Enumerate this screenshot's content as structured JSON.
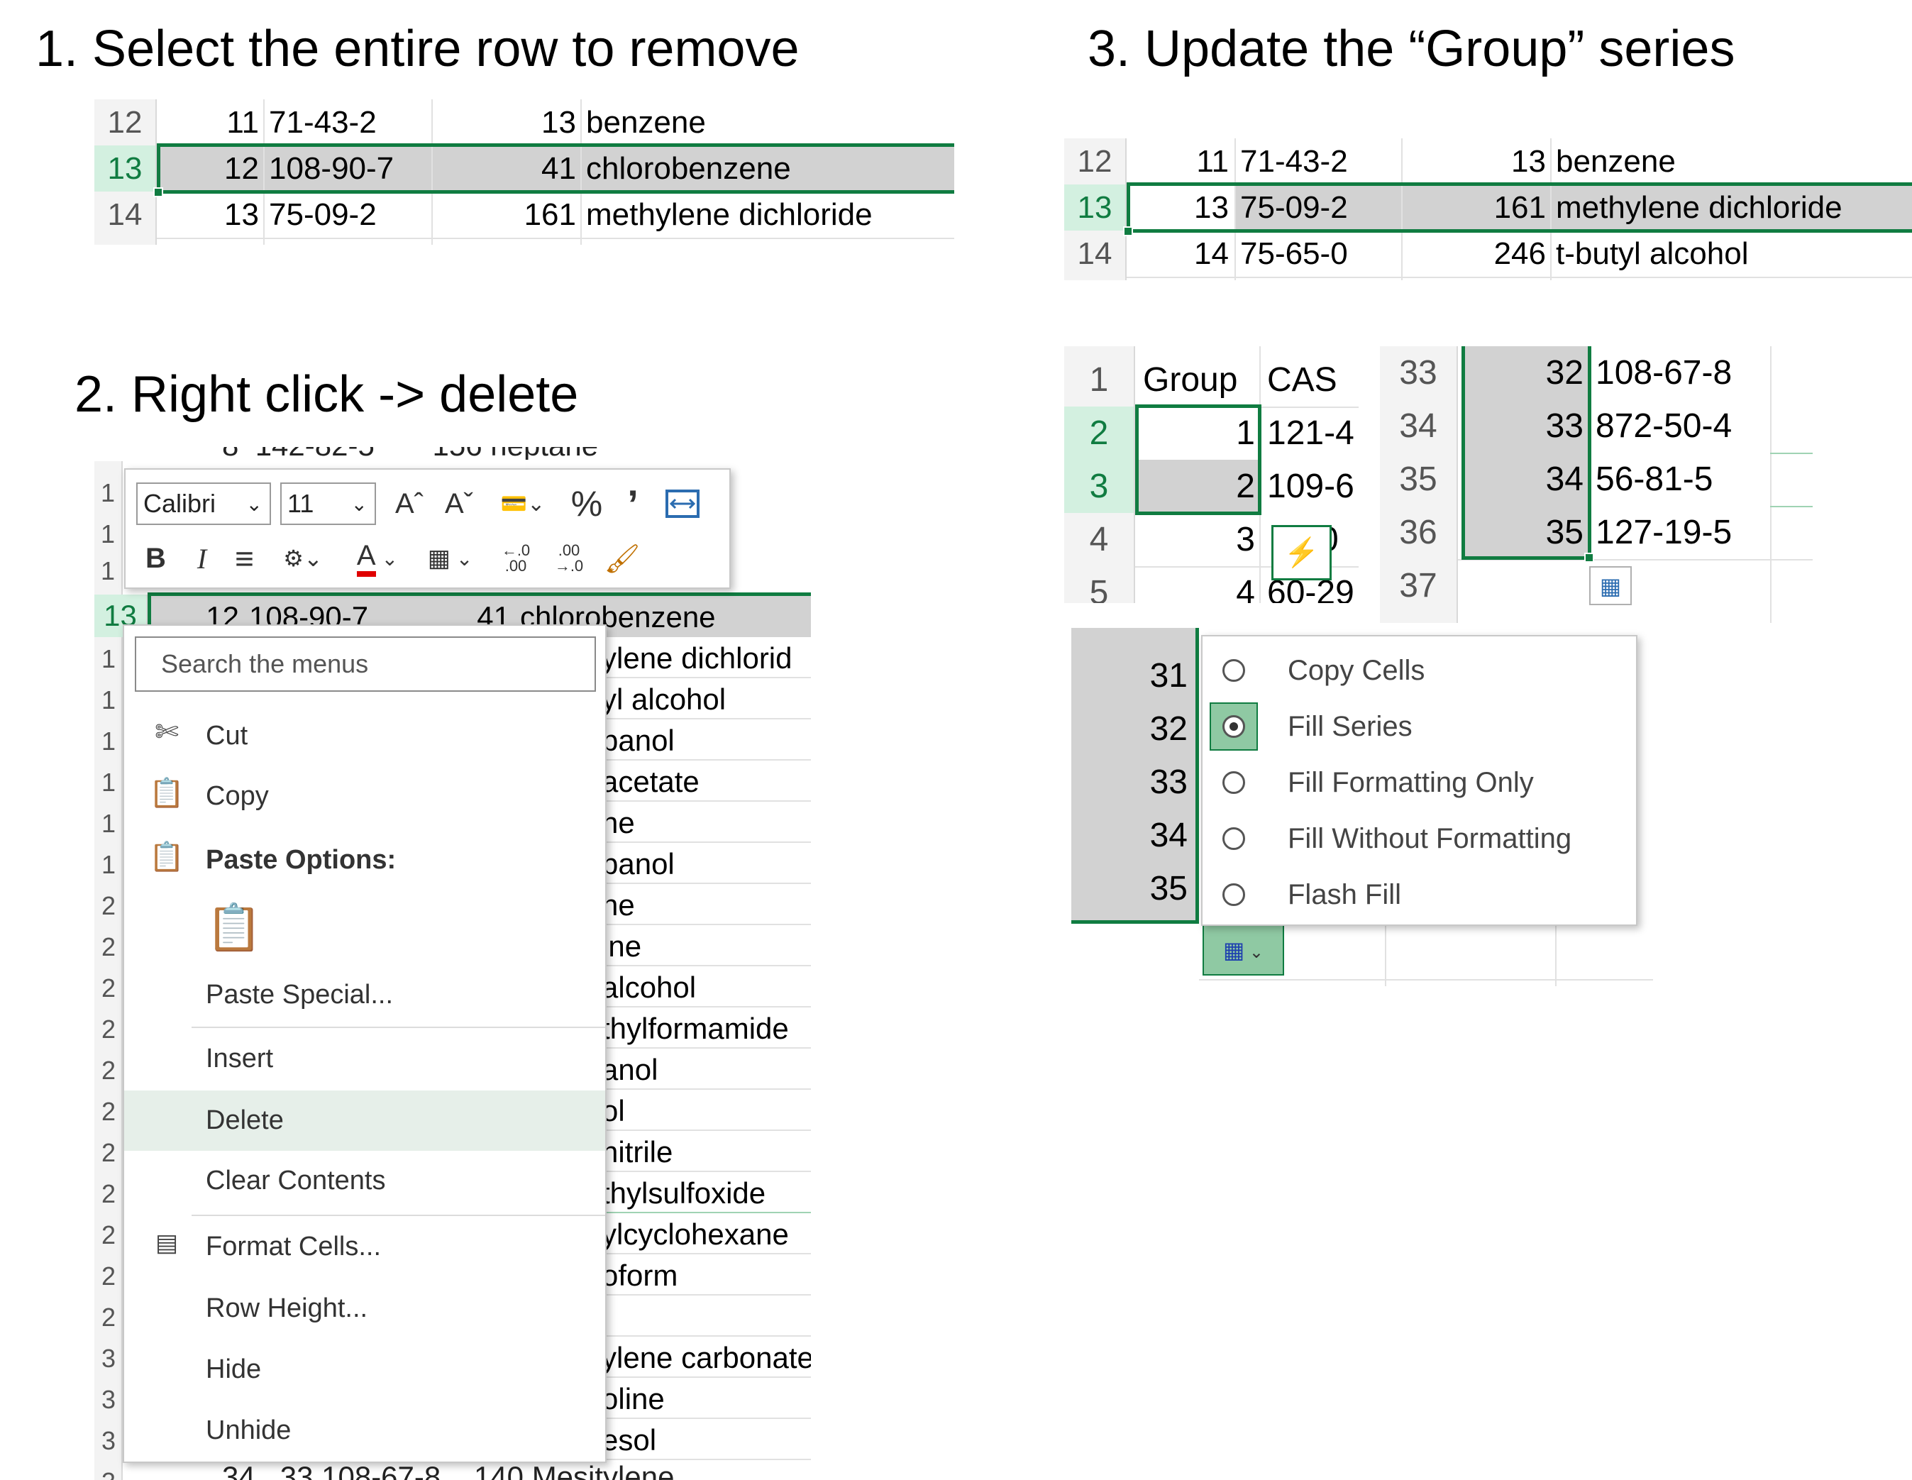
{
  "steps": {
    "s1": "1. Select the entire row to remove",
    "s2": "2. Right click -> delete",
    "s3": "3. Update the “Group” series"
  },
  "grid1": {
    "rows": [
      {
        "h": "12",
        "g": "11",
        "cas": "71-43-2",
        "n": "13",
        "name": "benzene"
      },
      {
        "h": "13",
        "g": "12",
        "cas": "108-90-7",
        "n": "41",
        "name": "chlorobenzene"
      },
      {
        "h": "14",
        "g": "13",
        "cas": "75-09-2",
        "n": "161",
        "name": "methylene dichloride"
      }
    ]
  },
  "grid3": {
    "rows": [
      {
        "h": "12",
        "g": "11",
        "cas": "71-43-2",
        "n": "13",
        "name": "benzene"
      },
      {
        "h": "13",
        "g": "13",
        "cas": "75-09-2",
        "n": "161",
        "name": "methylene dichloride"
      },
      {
        "h": "14",
        "g": "14",
        "cas": "75-65-0",
        "n": "246",
        "name": "t-butyl alcohol"
      }
    ]
  },
  "grid2": {
    "top_partial": {
      "g": "8",
      "cas": "142-82-5",
      "n": "156",
      "name": "heptane"
    },
    "hdrs_visible": [
      "1",
      "1",
      "1"
    ],
    "sel_row": {
      "h": "13",
      "g": "12",
      "cas": "108-90-7",
      "n": "41",
      "name": "chlorobenzene"
    },
    "right_col": [
      "ylene dichlorid",
      "yl alcohol",
      "panol",
      "acetate",
      "ne",
      "panol",
      "ne",
      "ine",
      "alcohol",
      "thylformamide",
      "anol",
      "ol",
      "nitrile",
      "thylsulfoxide",
      "ylcyclohexane",
      "oform",
      "",
      "ylene carbonate",
      "oline",
      "esol"
    ],
    "left_hdr": [
      "1",
      "1",
      "1",
      "1",
      "1",
      "1",
      "2",
      "2",
      "2",
      "2",
      "2",
      "2",
      "2",
      "2",
      "2",
      "2",
      "2",
      "3",
      "3",
      "3",
      "3"
    ],
    "bottom_partial": {
      "h": "34",
      "g": "33",
      "cas": "108-67-8",
      "n": "140",
      "name": "Mesitylene"
    }
  },
  "mini_toolbar": {
    "font": "Calibri",
    "size": "11",
    "grow": "Aˆ",
    "shrink": "Aˇ",
    "percent": "%",
    "comma": "’",
    "bold": "B",
    "italic": "I",
    "font_color": "A",
    "inc_dec": "←.0 .00",
    "dec_dec": ".00 →.0"
  },
  "context_menu": {
    "search_placeholder": "Search the menus",
    "cut": "Cut",
    "copy": "Copy",
    "paste_options": "Paste Options:",
    "paste_special": "Paste Special...",
    "insert": "Insert",
    "delete": "Delete",
    "clear_contents": "Clear Contents",
    "format_cells": "Format Cells...",
    "row_height": "Row Height...",
    "hide": "Hide",
    "unhide": "Unhide"
  },
  "grid4": {
    "rows": [
      {
        "h": "1",
        "g": "Group",
        "cas": "CAS"
      },
      {
        "h": "2",
        "g": "1",
        "cas": "121-4"
      },
      {
        "h": "3",
        "g": "2",
        "cas": "109-6"
      },
      {
        "h": "4",
        "g": "3",
        "cas": "0"
      },
      {
        "h": "5",
        "g": "4",
        "cas": "60-29"
      }
    ]
  },
  "grid5": {
    "rows": [
      {
        "h": "33",
        "g": "32",
        "cas": "108-67-8"
      },
      {
        "h": "34",
        "g": "33",
        "cas": "872-50-4"
      },
      {
        "h": "35",
        "g": "34",
        "cas": "56-81-5"
      },
      {
        "h": "36",
        "g": "35",
        "cas": "127-19-5"
      },
      {
        "h": "37",
        "g": "",
        "cas": ""
      }
    ]
  },
  "autofill": {
    "rows": [
      "31",
      "32",
      "33",
      "34",
      "35"
    ],
    "options": [
      {
        "label": "Copy Cells",
        "selected": false
      },
      {
        "label": "Fill Series",
        "selected": true
      },
      {
        "label": "Fill Formatting Only",
        "selected": false
      },
      {
        "label": "Fill Without Formatting",
        "selected": false
      },
      {
        "label": "Flash Fill",
        "selected": false
      }
    ]
  },
  "colors": {
    "excel_green": "#107c41",
    "selection_gray": "#d2d2d2",
    "header_sel_bg": "#d3f0e0",
    "font_red": "#e00000"
  }
}
